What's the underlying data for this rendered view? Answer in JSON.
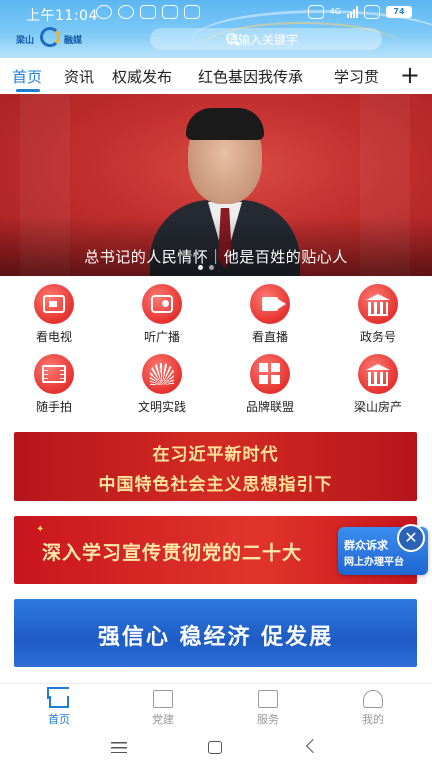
{
  "status_bar": {
    "time": "上午11:04",
    "network": "4G",
    "battery": "74"
  },
  "header": {
    "logo_left": "梁山",
    "logo_right": "融媒",
    "search_placeholder": "请输入关键字"
  },
  "tabs": [
    {
      "label": "首页",
      "active": true
    },
    {
      "label": "资讯"
    },
    {
      "label": "权威发布"
    },
    {
      "label": "红色基因我传承"
    },
    {
      "label": "学习贯"
    }
  ],
  "hero": {
    "caption": "总书记的人民情怀｜他是百姓的贴心人",
    "slide_index": 1,
    "slide_count": 2
  },
  "shortcuts": [
    {
      "label": "看电视",
      "icon": "tv-icon"
    },
    {
      "label": "听广播",
      "icon": "radio-icon"
    },
    {
      "label": "看直播",
      "icon": "video-camera-icon"
    },
    {
      "label": "政务号",
      "icon": "government-building-icon"
    },
    {
      "label": "随手拍",
      "icon": "film-strip-icon"
    },
    {
      "label": "文明实践",
      "icon": "fan-emblem-icon"
    },
    {
      "label": "品牌联盟",
      "icon": "grid-blocks-icon"
    },
    {
      "label": "梁山房产",
      "icon": "building-icon"
    }
  ],
  "banners": {
    "banner1_line1": "在习近平新时代",
    "banner1_line2": "中国特色社会主义思想指引下",
    "banner2_text": "深入学习宣传贯彻党的二十大",
    "banner3_text": "强信心 稳经济 促发展"
  },
  "floating": {
    "line1": "群众诉求",
    "line2": "网上办理平台",
    "close_icon": "close-icon"
  },
  "bottom_nav": [
    {
      "label": "首页",
      "icon": "home-icon",
      "active": true
    },
    {
      "label": "党建",
      "icon": "party-building-icon"
    },
    {
      "label": "服务",
      "icon": "star-badge-icon"
    },
    {
      "label": "我的",
      "icon": "user-icon"
    }
  ],
  "colors": {
    "accent": "#1f7fd8",
    "red": "#e5322f",
    "header_blue": "#5cb6f2"
  }
}
